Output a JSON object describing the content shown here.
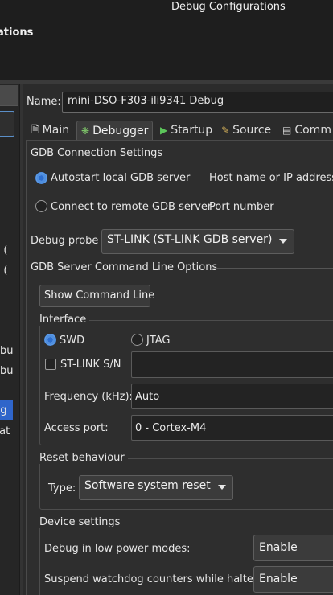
{
  "window": {
    "title": "Debug Configurations"
  },
  "header": {
    "title": "ations"
  },
  "sidebar": {
    "items": [
      {
        "label": "g ("
      },
      {
        "label": "g ("
      },
      {
        "label": "ebu"
      },
      {
        "label": "ebu"
      },
      {
        "label": "ug"
      },
      {
        "label": "cat"
      }
    ]
  },
  "name_row": {
    "label": "Name:",
    "value": "mini-DSO-F303-ili9341 Debug"
  },
  "tabs": [
    {
      "label": "Main",
      "icon": "document-icon"
    },
    {
      "label": "Debugger",
      "icon": "bug-icon"
    },
    {
      "label": "Startup",
      "icon": "play-icon"
    },
    {
      "label": "Source",
      "icon": "source-icon"
    },
    {
      "label": "Comm",
      "icon": "common-icon"
    }
  ],
  "gdb_connection": {
    "title": "GDB Connection Settings",
    "autostart_label": "Autostart local GDB server",
    "host_label": "Host name or IP address",
    "remote_label": "Connect to remote GDB server",
    "port_label": "Port number"
  },
  "debug_probe": {
    "label": "Debug probe",
    "value": "ST-LINK (ST-LINK GDB server)"
  },
  "server_options": {
    "title": "GDB Server Command Line Options",
    "show_button": "Show Command Line"
  },
  "interface": {
    "title": "Interface",
    "swd_label": "SWD",
    "jtag_label": "JTAG",
    "serial_label": "ST-LINK S/N",
    "frequency_label": "Frequency (kHz):",
    "frequency_value": "Auto",
    "access_label": "Access port:",
    "access_value": "0 - Cortex-M4"
  },
  "reset": {
    "title": "Reset behaviour",
    "type_label": "Type:",
    "type_value": "Software system reset"
  },
  "device": {
    "title": "Device settings",
    "low_power_label": "Debug in low power modes:",
    "low_power_value": "Enable",
    "watchdog_label": "Suspend watchdog counters while halted:",
    "watchdog_value": "Enable"
  },
  "colors": {
    "accent": "#2f65ca",
    "background": "#2b2b2b",
    "panel": "#2e2e2e"
  }
}
